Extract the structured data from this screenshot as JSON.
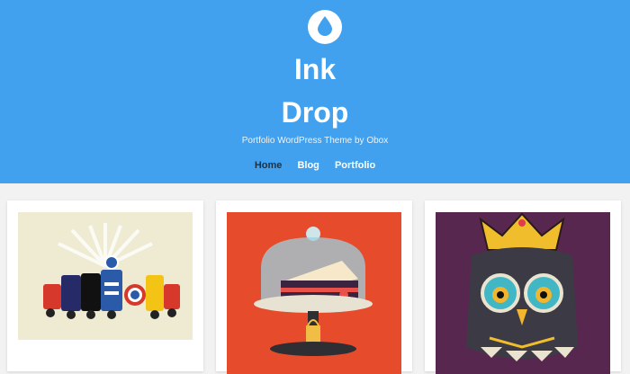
{
  "site": {
    "title_line_1": "Ink",
    "title_line_2": "Drop",
    "tagline": "Portfolio WordPress Theme by Obox",
    "logo_icon": "water-drop-icon"
  },
  "nav": {
    "items": [
      {
        "label": "Home",
        "active": true
      },
      {
        "label": "Blog",
        "active": false
      },
      {
        "label": "Portfolio",
        "active": false
      }
    ]
  },
  "colors": {
    "header_bg": "#41a1ef",
    "page_bg": "#f2f2f2",
    "active_nav": "#1b3247"
  },
  "portfolio": {
    "items": [
      {
        "image": "superhero-scooters-illustration"
      },
      {
        "image": "locked-cake-dome-illustration"
      },
      {
        "image": "crowned-owl-illustration"
      }
    ]
  }
}
